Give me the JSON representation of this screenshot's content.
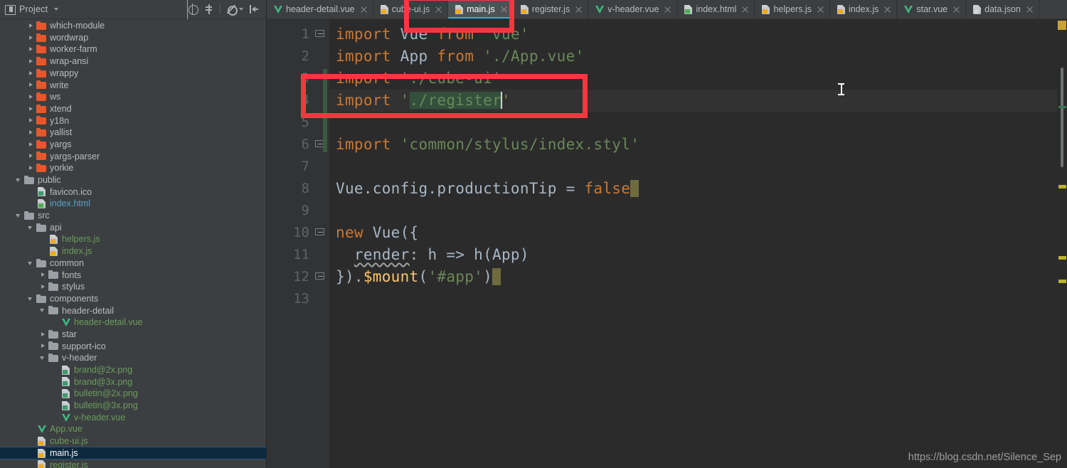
{
  "sidebar": {
    "title": "Project",
    "title_icon": "project-panel-icon",
    "tools": [
      {
        "name": "locate-file-icon",
        "label": "Select Opened File"
      },
      {
        "name": "expand-all-icon",
        "label": "Expand All"
      },
      {
        "name": "settings-gear-icon",
        "label": "Settings"
      },
      {
        "name": "hide-panel-icon",
        "label": "Hide"
      }
    ],
    "tree": [
      {
        "label": "which-module",
        "type": "folder-orange",
        "arrow": "right",
        "indent": 2,
        "color": "gray"
      },
      {
        "label": "wordwrap",
        "type": "folder-orange",
        "arrow": "right",
        "indent": 2,
        "color": "gray"
      },
      {
        "label": "worker-farm",
        "type": "folder-orange",
        "arrow": "right",
        "indent": 2,
        "color": "gray"
      },
      {
        "label": "wrap-ansi",
        "type": "folder-orange",
        "arrow": "right",
        "indent": 2,
        "color": "gray"
      },
      {
        "label": "wrappy",
        "type": "folder-orange",
        "arrow": "right",
        "indent": 2,
        "color": "gray"
      },
      {
        "label": "write",
        "type": "folder-orange",
        "arrow": "right",
        "indent": 2,
        "color": "gray"
      },
      {
        "label": "ws",
        "type": "folder-orange",
        "arrow": "right",
        "indent": 2,
        "color": "gray"
      },
      {
        "label": "xtend",
        "type": "folder-orange",
        "arrow": "right",
        "indent": 2,
        "color": "gray"
      },
      {
        "label": "y18n",
        "type": "folder-orange",
        "arrow": "right",
        "indent": 2,
        "color": "gray"
      },
      {
        "label": "yallist",
        "type": "folder-orange",
        "arrow": "right",
        "indent": 2,
        "color": "gray"
      },
      {
        "label": "yargs",
        "type": "folder-orange",
        "arrow": "right",
        "indent": 2,
        "color": "gray"
      },
      {
        "label": "yargs-parser",
        "type": "folder-orange",
        "arrow": "right",
        "indent": 2,
        "color": "gray"
      },
      {
        "label": "yorkie",
        "type": "folder-orange",
        "arrow": "right",
        "indent": 2,
        "color": "gray"
      },
      {
        "label": "public",
        "type": "folder-gray",
        "arrow": "down",
        "indent": 1,
        "color": "gray"
      },
      {
        "label": "favicon.ico",
        "type": "file-img",
        "arrow": "none",
        "indent": 2,
        "color": "gray"
      },
      {
        "label": "index.html",
        "type": "file-html",
        "arrow": "none",
        "indent": 2,
        "color": "blue"
      },
      {
        "label": "src",
        "type": "folder-gray",
        "arrow": "down",
        "indent": 1,
        "color": "gray"
      },
      {
        "label": "api",
        "type": "folder-gray",
        "arrow": "down",
        "indent": 2,
        "color": "gray"
      },
      {
        "label": "helpers.js",
        "type": "file-js",
        "arrow": "none",
        "indent": 3,
        "color": "green"
      },
      {
        "label": "index.js",
        "type": "file-js",
        "arrow": "none",
        "indent": 3,
        "color": "green"
      },
      {
        "label": "common",
        "type": "folder-gray",
        "arrow": "down",
        "indent": 2,
        "color": "gray"
      },
      {
        "label": "fonts",
        "type": "folder-gray",
        "arrow": "right",
        "indent": 3,
        "color": "gray"
      },
      {
        "label": "stylus",
        "type": "folder-gray",
        "arrow": "right",
        "indent": 3,
        "color": "gray"
      },
      {
        "label": "components",
        "type": "folder-gray",
        "arrow": "down",
        "indent": 2,
        "color": "gray"
      },
      {
        "label": "header-detail",
        "type": "folder-gray",
        "arrow": "down",
        "indent": 3,
        "color": "gray"
      },
      {
        "label": "header-detail.vue",
        "type": "file-vue",
        "arrow": "none",
        "indent": 4,
        "color": "green"
      },
      {
        "label": "star",
        "type": "folder-gray",
        "arrow": "right",
        "indent": 3,
        "color": "gray"
      },
      {
        "label": "support-ico",
        "type": "folder-gray",
        "arrow": "right",
        "indent": 3,
        "color": "gray"
      },
      {
        "label": "v-header",
        "type": "folder-gray",
        "arrow": "down",
        "indent": 3,
        "color": "gray"
      },
      {
        "label": "brand@2x.png",
        "type": "file-img",
        "arrow": "none",
        "indent": 4,
        "color": "green"
      },
      {
        "label": "brand@3x.png",
        "type": "file-img",
        "arrow": "none",
        "indent": 4,
        "color": "green"
      },
      {
        "label": "bulletin@2x.png",
        "type": "file-img",
        "arrow": "none",
        "indent": 4,
        "color": "green"
      },
      {
        "label": "bulletin@3x.png",
        "type": "file-img",
        "arrow": "none",
        "indent": 4,
        "color": "green"
      },
      {
        "label": "v-header.vue",
        "type": "file-vue",
        "arrow": "none",
        "indent": 4,
        "color": "green"
      },
      {
        "label": "App.vue",
        "type": "file-vue",
        "arrow": "none",
        "indent": 2,
        "color": "green"
      },
      {
        "label": "cube-ui.js",
        "type": "file-js",
        "arrow": "none",
        "indent": 2,
        "color": "green"
      },
      {
        "label": "main.js",
        "type": "file-js",
        "arrow": "none",
        "indent": 2,
        "color": "white",
        "selected": true
      },
      {
        "label": "register.js",
        "type": "file-js",
        "arrow": "none",
        "indent": 2,
        "color": "green"
      }
    ]
  },
  "tabs": [
    {
      "label": "header-detail.vue",
      "icon": "vue-file-icon",
      "active": false
    },
    {
      "label": "cube-ui.js",
      "icon": "js-file-icon",
      "active": false
    },
    {
      "label": "main.js",
      "icon": "js-file-icon",
      "active": true
    },
    {
      "label": "register.js",
      "icon": "js-file-icon",
      "active": false
    },
    {
      "label": "v-header.vue",
      "icon": "vue-file-icon",
      "active": false
    },
    {
      "label": "index.html",
      "icon": "html-file-icon",
      "active": false
    },
    {
      "label": "helpers.js",
      "icon": "js-file-icon",
      "active": false
    },
    {
      "label": "index.js",
      "icon": "js-file-icon",
      "active": false
    },
    {
      "label": "star.vue",
      "icon": "vue-file-icon",
      "active": false
    },
    {
      "label": "data.json",
      "icon": "json-file-icon",
      "active": false
    }
  ],
  "editor": {
    "filename": "main.js",
    "line_numbers": [
      "1",
      "2",
      "3",
      "4",
      "5",
      "6",
      "7",
      "8",
      "9",
      "10",
      "11",
      "12",
      "13"
    ],
    "current_line": 4,
    "lines": [
      {
        "n": "1",
        "text": "import Vue from 'vue'"
      },
      {
        "n": "2",
        "text": "import App from './App.vue'"
      },
      {
        "n": "3",
        "text": "import './cube-ui'"
      },
      {
        "n": "4",
        "text": "import './register'"
      },
      {
        "n": "5",
        "text": ""
      },
      {
        "n": "6",
        "text": "import 'common/stylus/index.styl'"
      },
      {
        "n": "7",
        "text": ""
      },
      {
        "n": "8",
        "text": "Vue.config.productionTip = false"
      },
      {
        "n": "9",
        "text": ""
      },
      {
        "n": "10",
        "text": "new Vue({"
      },
      {
        "n": "11",
        "text": "  render: h => h(App)"
      },
      {
        "n": "12",
        "text": "}).$mount('#app')"
      },
      {
        "n": "13",
        "text": ""
      }
    ]
  },
  "annotations": [
    {
      "name": "tab-highlight-box",
      "color": "#fb3640"
    },
    {
      "name": "import-register-highlight-box",
      "color": "#fb3640"
    }
  ],
  "watermark": "https://blog.csdn.net/Silence_Sep",
  "colors": {
    "accent_tab": "#3ba9d4",
    "annotation_red": "#fb3640",
    "keyword": "#cc7832",
    "string": "#6a8759",
    "identifier": "#a9b7c6",
    "function": "#ffc66d",
    "editor_bg": "#2b2b2b",
    "panel_bg": "#3c3f41",
    "selection_bg": "#0d293e",
    "vue_green": "#41b883",
    "folder_orange": "#e8562b"
  }
}
